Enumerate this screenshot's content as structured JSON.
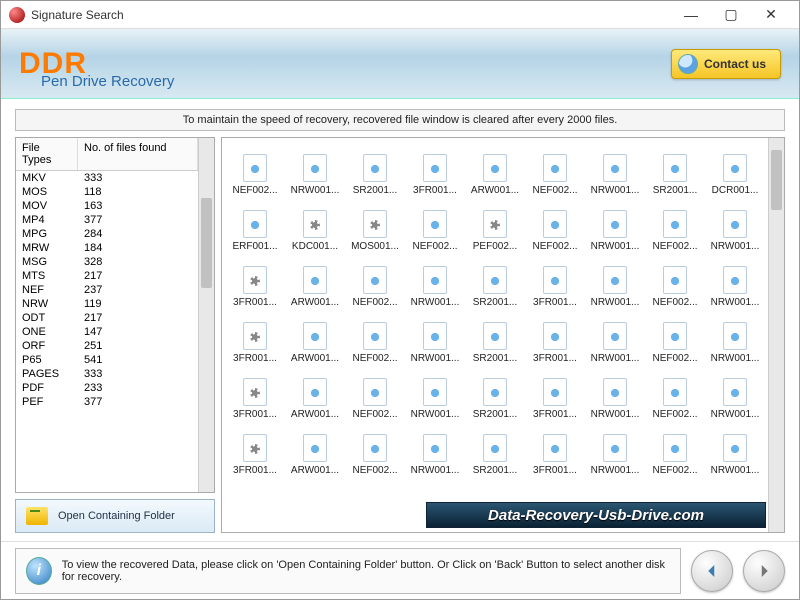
{
  "window": {
    "title": "Signature Search"
  },
  "header": {
    "logo": "DDR",
    "subtitle": "Pen Drive Recovery",
    "contact_label": "Contact us"
  },
  "info_strip": "To maintain the speed of recovery, recovered file window is cleared after every 2000 files.",
  "type_table": {
    "col1": "File Types",
    "col2": "No. of files found",
    "rows": [
      {
        "t": "MKV",
        "n": "333"
      },
      {
        "t": "MOS",
        "n": "118"
      },
      {
        "t": "MOV",
        "n": "163"
      },
      {
        "t": "MP4",
        "n": "377"
      },
      {
        "t": "MPG",
        "n": "284"
      },
      {
        "t": "MRW",
        "n": "184"
      },
      {
        "t": "MSG",
        "n": "328"
      },
      {
        "t": "MTS",
        "n": "217"
      },
      {
        "t": "NEF",
        "n": "237"
      },
      {
        "t": "NRW",
        "n": "119"
      },
      {
        "t": "ODT",
        "n": "217"
      },
      {
        "t": "ONE",
        "n": "147"
      },
      {
        "t": "ORF",
        "n": "251"
      },
      {
        "t": "P65",
        "n": "541"
      },
      {
        "t": "PAGES",
        "n": "333"
      },
      {
        "t": "PDF",
        "n": "233"
      },
      {
        "t": "PEF",
        "n": "377"
      }
    ]
  },
  "open_folder_label": "Open Containing Folder",
  "files": [
    {
      "n": "NEF002...",
      "k": "d"
    },
    {
      "n": "NRW001...",
      "k": "d"
    },
    {
      "n": "SR2001...",
      "k": "d"
    },
    {
      "n": "3FR001...",
      "k": "d"
    },
    {
      "n": "ARW001...",
      "k": "d"
    },
    {
      "n": "NEF002...",
      "k": "d"
    },
    {
      "n": "NRW001...",
      "k": "d"
    },
    {
      "n": "SR2001...",
      "k": "d"
    },
    {
      "n": "DCR001...",
      "k": "d"
    },
    {
      "n": "ERF001...",
      "k": "d"
    },
    {
      "n": "KDC001...",
      "k": "g"
    },
    {
      "n": "MOS001...",
      "k": "g"
    },
    {
      "n": "NEF002...",
      "k": "d"
    },
    {
      "n": "PEF002...",
      "k": "g"
    },
    {
      "n": "NEF002...",
      "k": "d"
    },
    {
      "n": "NRW001...",
      "k": "d"
    },
    {
      "n": "NEF002...",
      "k": "d"
    },
    {
      "n": "NRW001...",
      "k": "d"
    },
    {
      "n": "3FR001...",
      "k": "g"
    },
    {
      "n": "ARW001...",
      "k": "d"
    },
    {
      "n": "NEF002...",
      "k": "d"
    },
    {
      "n": "NRW001...",
      "k": "d"
    },
    {
      "n": "SR2001...",
      "k": "d"
    },
    {
      "n": "3FR001...",
      "k": "d"
    },
    {
      "n": "NRW001...",
      "k": "d"
    },
    {
      "n": "NEF002...",
      "k": "d"
    },
    {
      "n": "NRW001...",
      "k": "d"
    },
    {
      "n": "3FR001...",
      "k": "g"
    },
    {
      "n": "ARW001...",
      "k": "d"
    },
    {
      "n": "NEF002...",
      "k": "d"
    },
    {
      "n": "NRW001...",
      "k": "d"
    },
    {
      "n": "SR2001...",
      "k": "d"
    },
    {
      "n": "3FR001...",
      "k": "d"
    },
    {
      "n": "NRW001...",
      "k": "d"
    },
    {
      "n": "NEF002...",
      "k": "d"
    },
    {
      "n": "NRW001...",
      "k": "d"
    },
    {
      "n": "3FR001...",
      "k": "g"
    },
    {
      "n": "ARW001...",
      "k": "d"
    },
    {
      "n": "NEF002...",
      "k": "d"
    },
    {
      "n": "NRW001...",
      "k": "d"
    },
    {
      "n": "SR2001...",
      "k": "d"
    },
    {
      "n": "3FR001...",
      "k": "d"
    },
    {
      "n": "NRW001...",
      "k": "d"
    },
    {
      "n": "NEF002...",
      "k": "d"
    },
    {
      "n": "NRW001...",
      "k": "d"
    },
    {
      "n": "3FR001...",
      "k": "g"
    },
    {
      "n": "ARW001...",
      "k": "d"
    },
    {
      "n": "NEF002...",
      "k": "d"
    },
    {
      "n": "NRW001...",
      "k": "d"
    },
    {
      "n": "SR2001...",
      "k": "d"
    },
    {
      "n": "3FR001...",
      "k": "d"
    },
    {
      "n": "NRW001...",
      "k": "d"
    },
    {
      "n": "NEF002...",
      "k": "d"
    },
    {
      "n": "NRW001...",
      "k": "d"
    }
  ],
  "brand_url": "Data-Recovery-Usb-Drive.com",
  "footer_text": "To view the recovered Data, please click on 'Open Containing Folder' button. Or Click on 'Back' Button to select another disk for recovery."
}
